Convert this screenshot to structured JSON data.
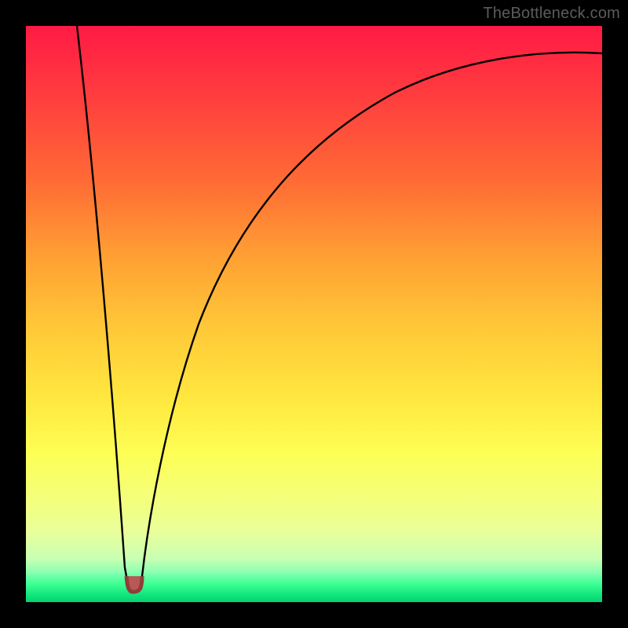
{
  "watermark": "TheBottleneck.com",
  "colors": {
    "frame": "#000000",
    "gradient_top": "#ff1a44",
    "gradient_mid": "#ffe83f",
    "gradient_bottom": "#06d070",
    "curve_stroke": "#000000",
    "nub_fill": "#b75a55",
    "nub_stroke": "#8f3e3a"
  },
  "chart_data": {
    "type": "line",
    "title": "",
    "xlabel": "",
    "ylabel": "",
    "xlim": [
      0,
      100
    ],
    "ylim": [
      0,
      100
    ],
    "grid": false,
    "legend": false,
    "series": [
      {
        "name": "left-branch",
        "x": [
          8.9,
          9.7,
          10.6,
          11.5,
          12.4,
          13.2,
          14.1,
          15.0,
          15.8,
          16.6,
          17.0,
          17.4
        ],
        "y": [
          100,
          91,
          82,
          73,
          64,
          55,
          46,
          37,
          28,
          19,
          10,
          4.5
        ]
      },
      {
        "name": "nub",
        "x": [
          17.4,
          17.7,
          18.2,
          18.9,
          19.5,
          19.9,
          20.2
        ],
        "y": [
          4.5,
          2.6,
          1.9,
          1.7,
          1.9,
          2.6,
          4.5
        ]
      },
      {
        "name": "right-branch",
        "x": [
          20.2,
          21,
          22,
          23.5,
          25,
          27,
          30,
          33,
          37,
          42,
          48,
          55,
          63,
          72,
          82,
          92,
          100
        ],
        "y": [
          4.5,
          11,
          19,
          29,
          37,
          46,
          55,
          62,
          68,
          74,
          79,
          83.5,
          87,
          90,
          92.3,
          94,
          95
        ]
      }
    ],
    "minimum": {
      "x": 18.9,
      "y": 1.7
    }
  }
}
